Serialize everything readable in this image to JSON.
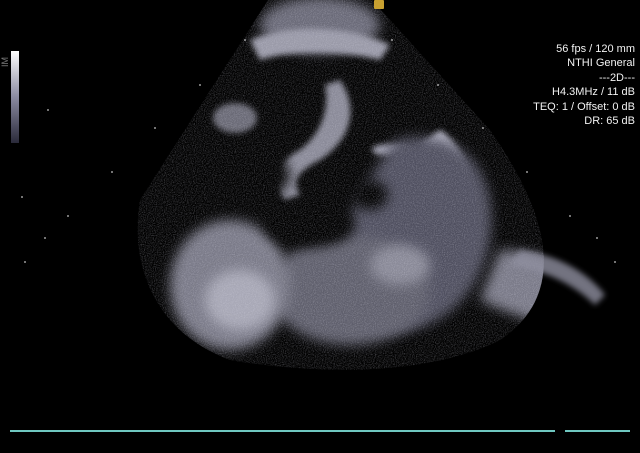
{
  "image_label": "IM",
  "overlay": {
    "frame_rate_depth": "56 fps / 120 mm",
    "preset": "NTHI General",
    "mode": "---2D---",
    "frequency_gain": "H4.3MHz / 11 dB",
    "teq_offset": "TEQ: 1 / Offset: 0 dB",
    "dynamic_range": "DR: 65 dB"
  },
  "colors": {
    "background": "#000000",
    "overlay_text": "#f2f2f2",
    "timeline": "#6fc7c0",
    "orientation_marker": "#c8a030"
  }
}
